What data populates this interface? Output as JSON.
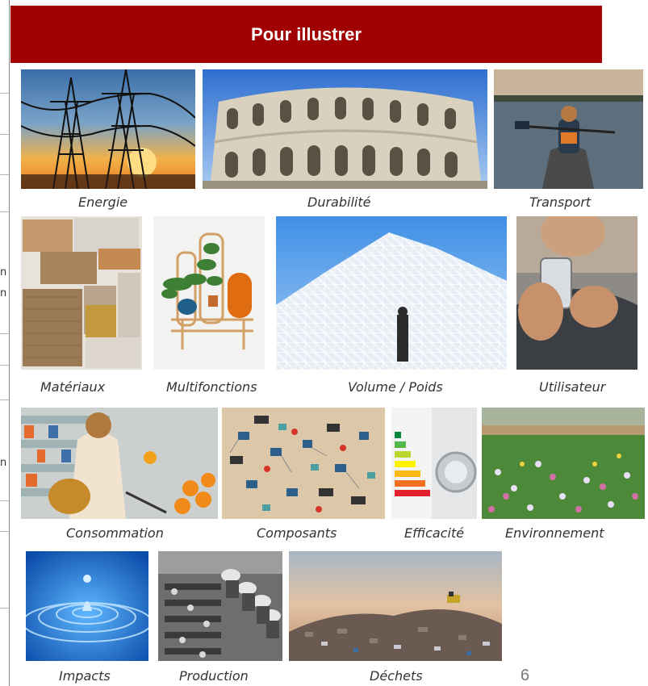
{
  "header": {
    "title": "Pour illustrer"
  },
  "page_number": "6",
  "edge_fragments": [
    "n",
    "n",
    "n"
  ],
  "tiles": [
    {
      "label": "Energie"
    },
    {
      "label": "Durabilité"
    },
    {
      "label": "Transport"
    },
    {
      "label": "Matériaux"
    },
    {
      "label": "Multifonctions"
    },
    {
      "label": "Volume / Poids"
    },
    {
      "label": "Utilisateur"
    },
    {
      "label": "Consommation"
    },
    {
      "label": "Composants"
    },
    {
      "label": "Efficacité"
    },
    {
      "label": "Environnement"
    },
    {
      "label": "Impacts"
    },
    {
      "label": "Production"
    },
    {
      "label": "Déchets"
    }
  ]
}
